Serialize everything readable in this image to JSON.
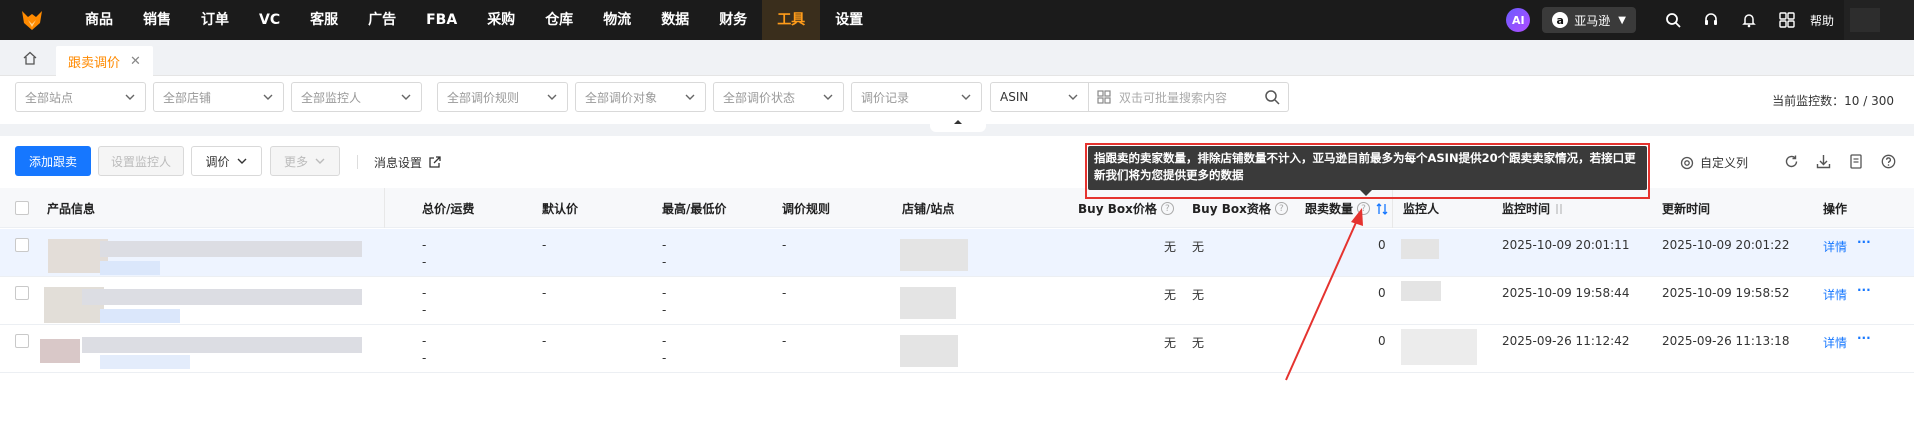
{
  "nav": {
    "items": [
      "商品",
      "销售",
      "订单",
      "VC",
      "客服",
      "广告",
      "FBA",
      "采购",
      "仓库",
      "物流",
      "数据",
      "财务",
      "工具",
      "设置"
    ],
    "active_index": 12,
    "ai_label": "AI",
    "store_icon": "a",
    "store_label": "亚马逊",
    "help_label": "帮助"
  },
  "tabs": {
    "current": "跟卖调价"
  },
  "filters": {
    "site": "全部站点",
    "store": "全部店铺",
    "monitor": "全部监控人",
    "rule": "全部调价规则",
    "target": "全部调价对象",
    "status": "全部调价状态",
    "record": "调价记录",
    "search_type": "ASIN",
    "search_placeholder": "双击可批量搜索内容",
    "monitor_count_label": "当前监控数：",
    "monitor_count_value": "10 / 300"
  },
  "toolbar": {
    "add": "添加跟卖",
    "set_monitor": "设置监控人",
    "adjust": "调价",
    "more": "更多",
    "message_settings": "消息设置",
    "custom_columns": "自定义列"
  },
  "tooltip": {
    "text": "指跟卖的卖家数量，排除店铺数量不计入，亚马逊目前最多为每个ASIN提供20个跟卖卖家情况，若接口更新我们将为您提供更多的数据"
  },
  "table": {
    "headers": {
      "product": "产品信息",
      "total_price": "总价/运费",
      "default_price": "默认价",
      "min_max": "最高/最低价",
      "rule": "调价规则",
      "store_site": "店铺/站点",
      "buybox_price": "Buy Box价格",
      "buybox_qual": "Buy Box资格",
      "seller_count": "跟卖数量",
      "monitor": "监控人",
      "monitor_time": "监控时间",
      "update_time": "更新时间",
      "action": "操作"
    },
    "rows": [
      {
        "total_a": "-",
        "total_b": "-",
        "default": "-",
        "minmax_a": "-",
        "minmax_b": "-",
        "rule": "-",
        "bb_price": "无",
        "bb_qual": "无",
        "count": "0",
        "monitor_time": "2025-10-09 20:01:11",
        "update_time": "2025-10-09 20:01:22",
        "detail": "详情",
        "more": "···"
      },
      {
        "total_a": "-",
        "total_b": "-",
        "default": "-",
        "minmax_a": "-",
        "minmax_b": "-",
        "rule": "-",
        "bb_price": "无",
        "bb_qual": "无",
        "count": "0",
        "monitor_time": "2025-10-09 19:58:44",
        "update_time": "2025-10-09 19:58:52",
        "detail": "详情",
        "more": "···"
      },
      {
        "total_a": "-",
        "total_b": "-",
        "default": "-",
        "minmax_a": "-",
        "minmax_b": "-",
        "rule": "-",
        "bb_price": "无",
        "bb_qual": "无",
        "count": "0",
        "monitor_time": "2025-09-26 11:12:42",
        "update_time": "2025-09-26 11:13:18",
        "detail": "详情",
        "more": "···"
      }
    ]
  },
  "colors": {
    "accent": "#ff9c1a",
    "primary": "#1677ff",
    "highlight": "#e5332f"
  }
}
